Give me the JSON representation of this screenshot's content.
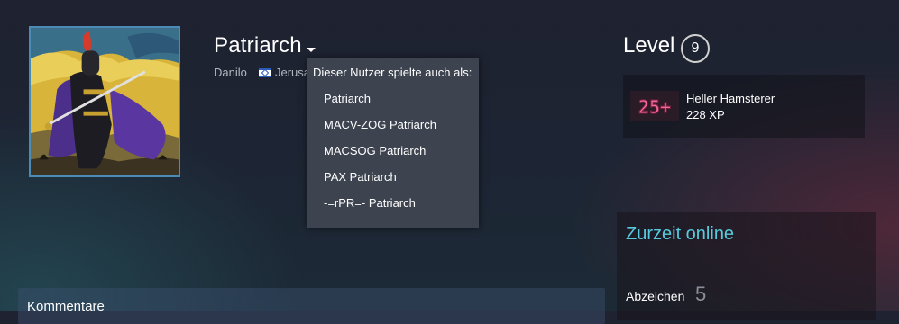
{
  "profile": {
    "persona_name": "Patriarch",
    "real_name": "Danilo",
    "location": "Jerusa",
    "flag": "israel-flag-icon",
    "avatar": "knight-avatar"
  },
  "alias_popup": {
    "title": "Dieser Nutzer spielte auch als:",
    "aliases": [
      "Patriarch",
      "MACV-ZOG Patriarch",
      "MACSOG Patriarch",
      "PAX Patriarch",
      "-=rPR=- Patriarch"
    ]
  },
  "level": {
    "label": "Level",
    "value": "9"
  },
  "featured_badge": {
    "icon_text": "25+",
    "name": "Heller Hamsterer",
    "xp": "228 XP"
  },
  "sidebar": {
    "online_status": "Zurzeit online",
    "badges_label": "Abzeichen",
    "badges_count": "5"
  },
  "comments": {
    "title": "Kommentare"
  },
  "colors": {
    "accent_online": "#57cbde",
    "popup_bg": "#3d4450",
    "avatar_border": "#4c8bb5"
  }
}
